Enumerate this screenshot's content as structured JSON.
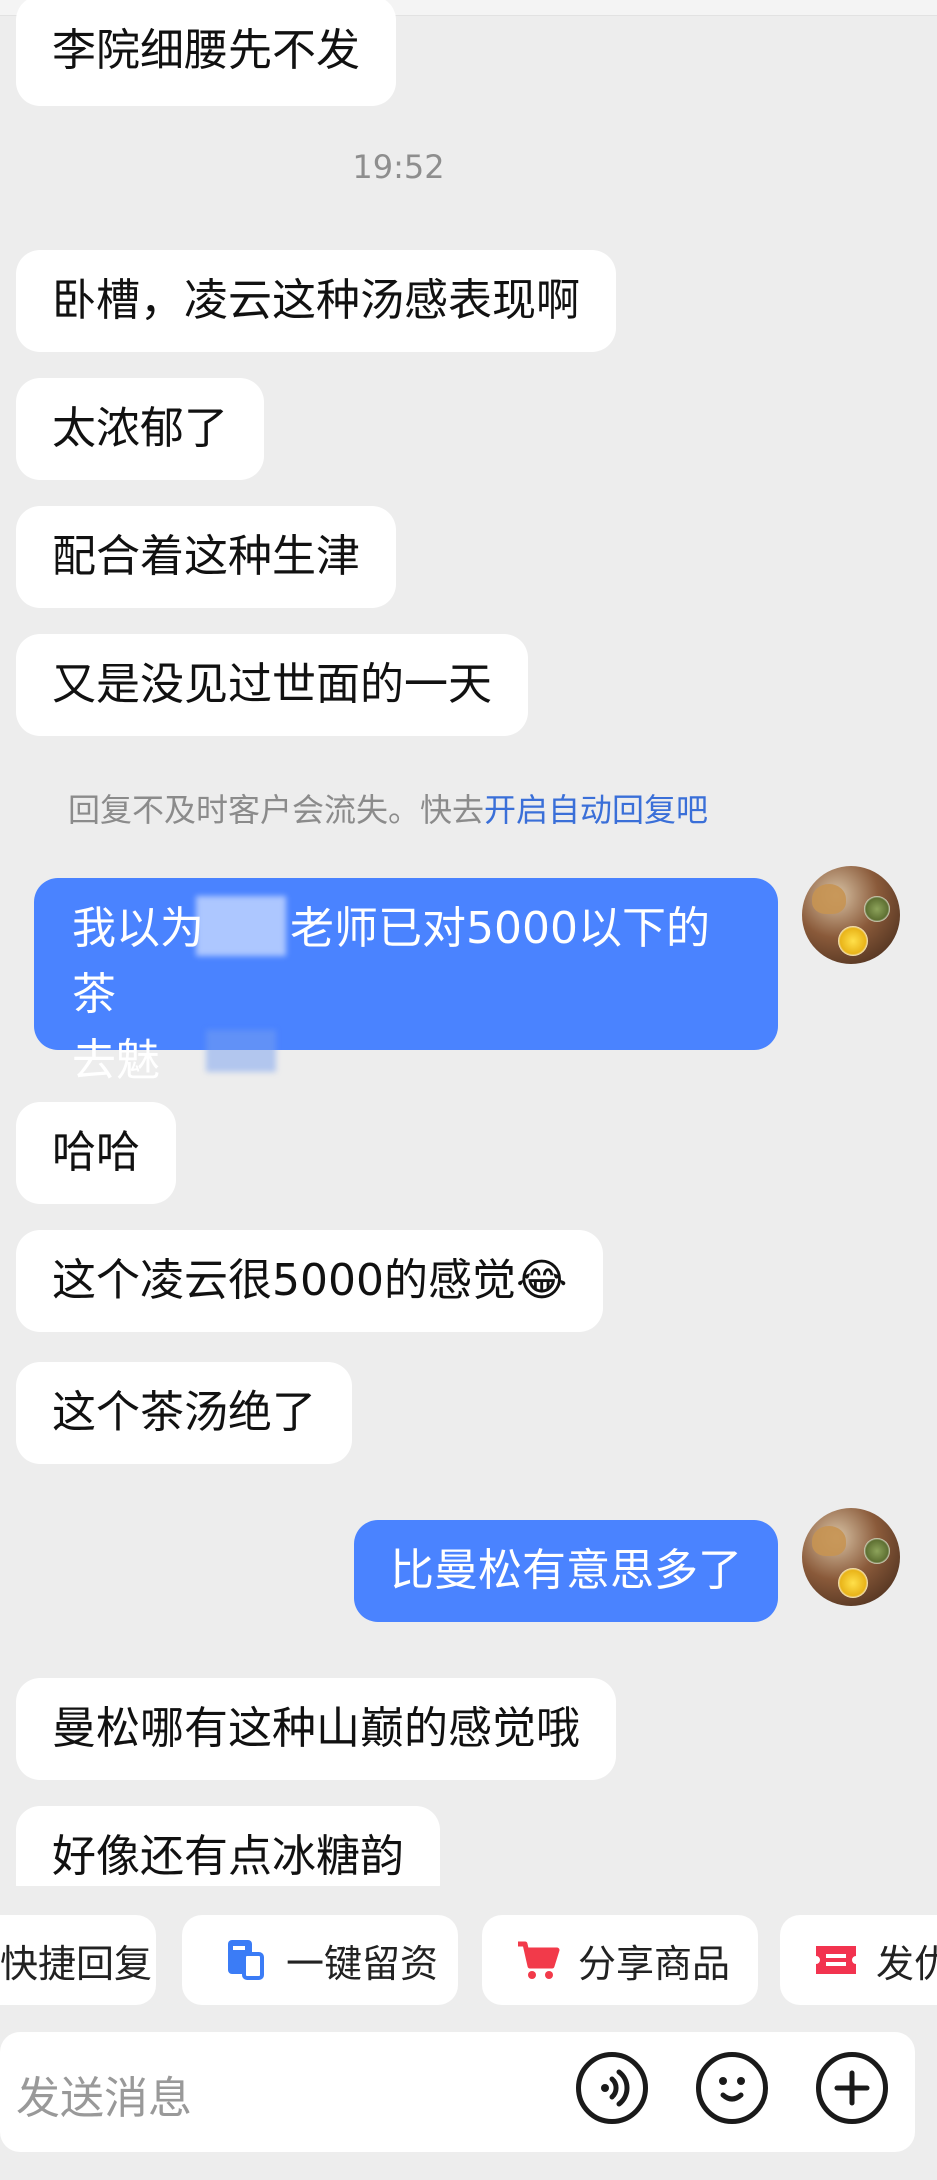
{
  "time_stamp": "19:52",
  "messages_top": [
    {
      "text": "李院细腰先不发"
    },
    {
      "text": "卧槽，凌云这种汤感表现啊"
    },
    {
      "text": "太浓郁了"
    },
    {
      "text": "配合着这种生津"
    },
    {
      "text": "又是没见过世面的一天"
    }
  ],
  "system_notice": {
    "prefix": "回复不及时客户会流失。快去",
    "link": "开启自动回复吧"
  },
  "my_message_1": {
    "line1_a": "我以为",
    "line1_b": "老师已对5000以下的茶",
    "line2": "去魅"
  },
  "messages_mid": [
    {
      "text": "哈哈"
    },
    {
      "text": "这个凌云很5000的感觉"
    },
    {
      "text": "这个茶汤绝了"
    }
  ],
  "my_message_2": {
    "text": "比曼松有意思多了"
  },
  "messages_bottom": [
    {
      "text": "曼松哪有这种山巅的感觉哦"
    },
    {
      "text": "好像还有点冰糖韵"
    }
  ],
  "emoji_laugh_cry": "😂",
  "quick_actions": [
    {
      "label": "快捷回复",
      "icon": "quick-reply-icon"
    },
    {
      "label": "一键留资",
      "icon": "contact-form-icon"
    },
    {
      "label": "分享商品",
      "icon": "cart-icon"
    },
    {
      "label": "发优",
      "icon": "coupon-icon"
    }
  ],
  "input": {
    "placeholder": "发送消息"
  },
  "colors": {
    "accent": "#4a83ff",
    "background": "#ededed",
    "link": "#3a6fd8",
    "cart": "#f23a4a",
    "coupon": "#f2334f",
    "form": "#3b7cf6"
  }
}
